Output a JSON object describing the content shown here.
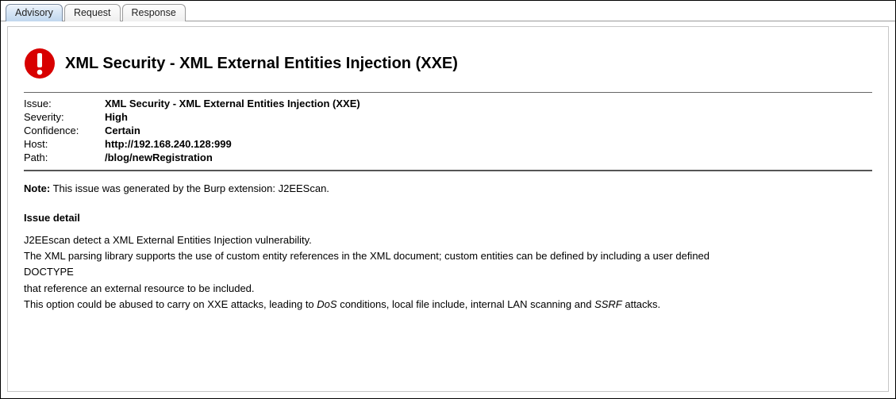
{
  "tabs": {
    "advisory": "Advisory",
    "request": "Request",
    "response": "Response"
  },
  "icon": {
    "name": "alert-icon",
    "color": "#d80000"
  },
  "title": "XML Security - XML External Entities Injection (XXE)",
  "summary": {
    "issue_label": "Issue:",
    "issue_value": "XML Security - XML External Entities Injection (XXE)",
    "severity_label": "Severity:",
    "severity_value": "High",
    "confidence_label": "Confidence:",
    "confidence_value": "Certain",
    "host_label": "Host:",
    "host_value": "http://192.168.240.128:999",
    "path_label": "Path:",
    "path_value": "/blog/newRegistration"
  },
  "note": {
    "label": "Note:",
    "text": " This issue was generated by the Burp extension: J2EEScan."
  },
  "detail": {
    "heading": "Issue detail",
    "p1": "J2EEscan detect a XML External Entities Injection vulnerability.",
    "p2": "The XML parsing library supports the use of custom entity references in the XML document; custom entities can be defined by including a user defined",
    "doctype": "DOCTYPE",
    "p3": "that reference an external resource to be included.",
    "p4_pre": "This option could be abused to carry on XXE attacks, leading to ",
    "p4_dos": "DoS",
    "p4_mid": " conditions, local file include, internal LAN scanning and ",
    "p4_ssrf": "SSRF",
    "p4_post": " attacks."
  }
}
